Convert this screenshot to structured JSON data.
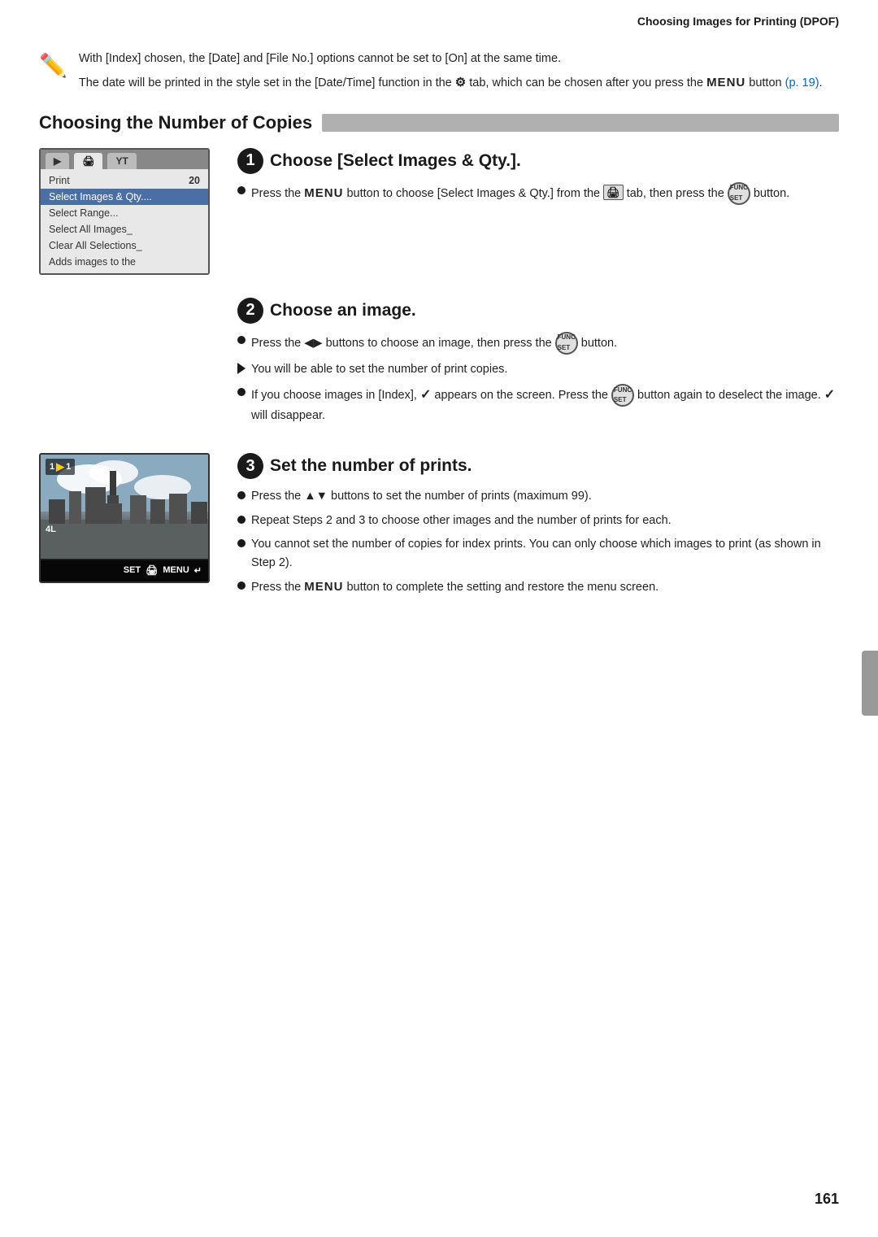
{
  "header": {
    "title": "Choosing Images for Printing (DPOF)"
  },
  "notes": [
    {
      "text": "With [Index] chosen, the [Date] and [File No.] options cannot be set to [On] at the same time."
    },
    {
      "text": "The date will be printed in the style set in the [Date/Time] function in the",
      "text2": " tab, which can be chosen after you press the MENU button",
      "link_text": "(p. 19)",
      "link_href": "#"
    }
  ],
  "section": {
    "heading": "Choosing the Number of Copies"
  },
  "steps": [
    {
      "number": "1",
      "title": "Choose [Select Images & Qty.].",
      "bullets": [
        {
          "type": "circle",
          "text": "Press the MENU button to choose [Select Images & Qty.] from the  tab, then press the  button."
        }
      ],
      "has_menu_image": true
    },
    {
      "number": "2",
      "title": "Choose an image.",
      "bullets": [
        {
          "type": "circle",
          "text": "Press the ◀▶ buttons to choose an image, then press the  button."
        },
        {
          "type": "triangle",
          "text": "You will be able to set the number of print copies."
        },
        {
          "type": "circle",
          "text": "If you choose images in [Index],  appears on the screen. Press the  button again to deselect the image.  will disappear."
        }
      ],
      "has_menu_image": false
    },
    {
      "number": "3",
      "title": "Set the number of prints.",
      "bullets": [
        {
          "type": "circle",
          "text": "Press the ▲▼ buttons to set the number of prints (maximum 99)."
        },
        {
          "type": "circle",
          "text": "Repeat Steps 2 and 3 to choose other images and the number of prints for each."
        },
        {
          "type": "circle",
          "text": "You cannot set the number of copies for index prints. You can only choose which images to print (as shown in Step 2)."
        },
        {
          "type": "circle",
          "text": "Press the MENU button to complete the setting and restore the menu screen."
        }
      ],
      "has_photo_image": true
    }
  ],
  "camera_menu": {
    "tabs": [
      "▶",
      "🖨",
      "YT"
    ],
    "active_tab": 1,
    "rows": [
      {
        "label": "Print",
        "value": "20",
        "highlighted": false
      },
      {
        "label": "Select Images & Qty....",
        "value": "",
        "highlighted": true
      },
      {
        "label": "Select Range...",
        "value": "",
        "highlighted": false
      },
      {
        "label": "Select All Images_",
        "value": "",
        "highlighted": false
      },
      {
        "label": "Clear All Selections_",
        "value": "",
        "highlighted": false
      },
      {
        "label": "Adds images to the",
        "value": "",
        "highlighted": false
      }
    ]
  },
  "camera_photo": {
    "counter": "1",
    "arrow": "▶",
    "count": "1",
    "size_label": "4L",
    "bottom_labels": [
      "SET",
      "🖨",
      "MENU",
      "↵"
    ]
  },
  "page_number": "161",
  "colors": {
    "accent_blue": "#4a6fa5",
    "link_blue": "#0066cc",
    "dark": "#1a1a1a",
    "mid_gray": "#b0b0b0"
  }
}
